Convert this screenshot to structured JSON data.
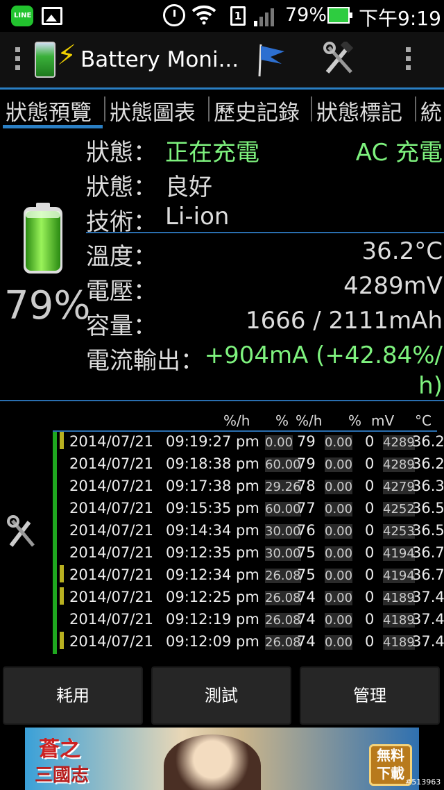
{
  "status_bar": {
    "line_app": "LINE",
    "sim_slot": "1",
    "battery_percent": "79%",
    "time": "下午9:19"
  },
  "action_bar": {
    "title": "Battery Moni..."
  },
  "tabs": [
    "狀態預覽",
    "狀態圖表",
    "歷史記錄",
    "狀態標記",
    "統"
  ],
  "info": {
    "battery_level": "79%",
    "status_label": "狀態：",
    "status_value": "正在充電",
    "charge_type": "AC 充電",
    "health_label": "狀態：",
    "health_value": "良好",
    "tech_label": "技術：",
    "tech_value": "Li-ion",
    "temp_label": "溫度：",
    "temp_value": "36.2°C",
    "voltage_label": "電壓：",
    "voltage_value": "4289mV",
    "capacity_label": "容量：",
    "capacity_value": "1666 / 2111mAh",
    "current_label": "電流輸出：",
    "current_value_line1": "+904mA (+42.84%/",
    "current_value_line2": "h)"
  },
  "history": {
    "headers": [
      "%/h",
      "%",
      "%/h",
      "%",
      "mV",
      "°C"
    ],
    "rows": [
      {
        "date": "2014/07/21",
        "time": "09:19:27 pm",
        "rate1": "0.00",
        "pct1": "79",
        "rate2": "0.00",
        "pct2": "0",
        "mv": "4289",
        "temp": "36.2",
        "yellow": true
      },
      {
        "date": "2014/07/21",
        "time": "09:18:38 pm",
        "rate1": "60.00",
        "pct1": "79",
        "rate2": "0.00",
        "pct2": "0",
        "mv": "4289",
        "temp": "36.2",
        "yellow": false
      },
      {
        "date": "2014/07/21",
        "time": "09:17:38 pm",
        "rate1": "29.26",
        "pct1": "78",
        "rate2": "0.00",
        "pct2": "0",
        "mv": "4279",
        "temp": "36.3",
        "yellow": false
      },
      {
        "date": "2014/07/21",
        "time": "09:15:35 pm",
        "rate1": "60.00",
        "pct1": "77",
        "rate2": "0.00",
        "pct2": "0",
        "mv": "4252",
        "temp": "36.5",
        "yellow": false
      },
      {
        "date": "2014/07/21",
        "time": "09:14:34 pm",
        "rate1": "30.00",
        "pct1": "76",
        "rate2": "0.00",
        "pct2": "0",
        "mv": "4253",
        "temp": "36.5",
        "yellow": false
      },
      {
        "date": "2014/07/21",
        "time": "09:12:35 pm",
        "rate1": "30.00",
        "pct1": "75",
        "rate2": "0.00",
        "pct2": "0",
        "mv": "4194",
        "temp": "36.7",
        "yellow": false
      },
      {
        "date": "2014/07/21",
        "time": "09:12:34 pm",
        "rate1": "26.08",
        "pct1": "75",
        "rate2": "0.00",
        "pct2": "0",
        "mv": "4194",
        "temp": "36.7",
        "yellow": true
      },
      {
        "date": "2014/07/21",
        "time": "09:12:25 pm",
        "rate1": "26.08",
        "pct1": "74",
        "rate2": "0.00",
        "pct2": "0",
        "mv": "4189",
        "temp": "37.4",
        "yellow": true
      },
      {
        "date": "2014/07/21",
        "time": "09:12:19 pm",
        "rate1": "26.08",
        "pct1": "74",
        "rate2": "0.00",
        "pct2": "0",
        "mv": "4189",
        "temp": "37.4",
        "yellow": false
      },
      {
        "date": "2014/07/21",
        "time": "09:12:09 pm",
        "rate1": "26.08",
        "pct1": "74",
        "rate2": "0.00",
        "pct2": "0",
        "mv": "4189",
        "temp": "37.4",
        "yellow": true
      }
    ]
  },
  "buttons": {
    "usage": "耗用",
    "test": "測試",
    "manage": "管理"
  },
  "ad": {
    "title": "蒼之",
    "subtitle": "三國志",
    "badge_line1": "無料",
    "badge_line2": "下載"
  },
  "watermark": "#513963",
  "colors": {
    "accent_blue": "#2a7fc4",
    "charging_green": "#7ef27e",
    "marker_green": "#1fa81f",
    "marker_yellow": "#b8b020"
  },
  "icons": [
    "line-app-icon",
    "picture-icon",
    "alarm-icon",
    "wifi-icon",
    "sim-icon",
    "signal-icon",
    "charging-battery-icon",
    "overflow-menu-icon",
    "flag-icon",
    "tools-icon",
    "battery-icon"
  ]
}
